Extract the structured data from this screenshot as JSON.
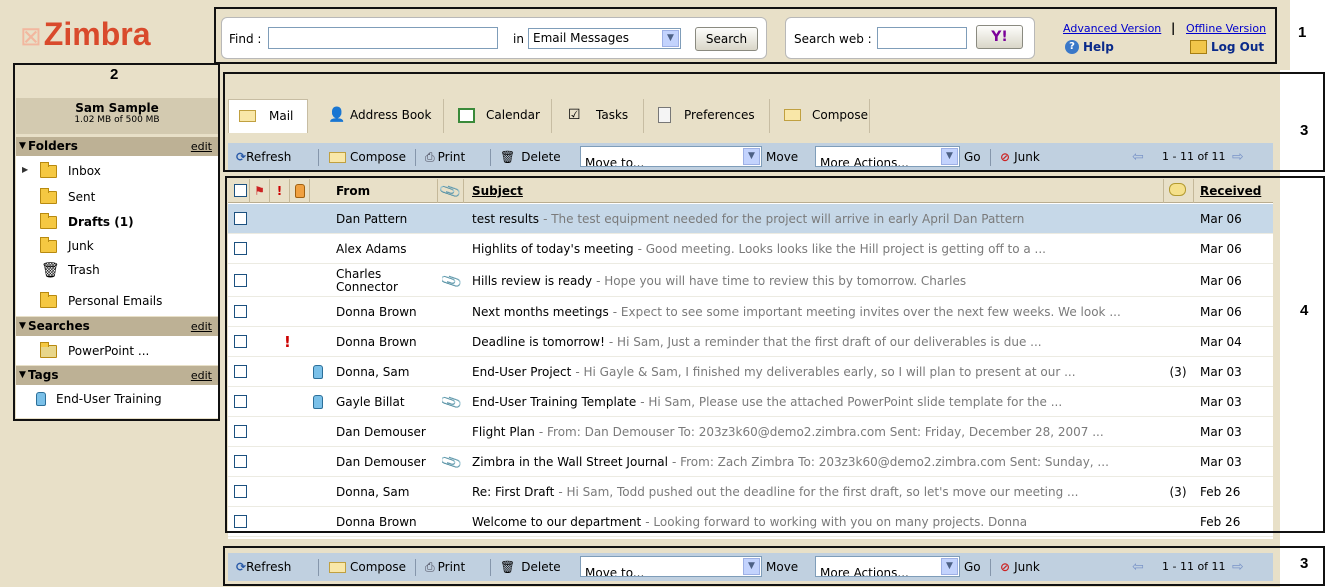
{
  "header": {
    "logo": "Zimbra",
    "find_label": "Find :",
    "in_label": "in",
    "search_scope": "Email Messages",
    "search_button": "Search",
    "search_web_label": "Search web :",
    "web_button": "Y!",
    "advanced_version": "Advanced Version",
    "separator": "|",
    "offline_version": "Offline Version",
    "help": "Help",
    "logout": "Log Out"
  },
  "callouts": {
    "c1": "1",
    "c2": "2",
    "c3": "3",
    "c4": "4",
    "c3b": "3"
  },
  "sidebar": {
    "user_name": "Sam Sample",
    "quota": "1.02 MB of 500 MB",
    "folders_header": "Folders",
    "edit": "edit",
    "folders": [
      {
        "label": "Inbox"
      },
      {
        "label": "Sent"
      },
      {
        "label": "Drafts (1)"
      },
      {
        "label": "Junk"
      },
      {
        "label": "Trash"
      },
      {
        "label": "Personal Emails"
      }
    ],
    "searches_header": "Searches",
    "searches": [
      {
        "label": "PowerPoint ..."
      }
    ],
    "tags_header": "Tags",
    "tags": [
      {
        "label": "End-User Training"
      }
    ]
  },
  "tabs": [
    {
      "label": "Mail"
    },
    {
      "label": "Address Book"
    },
    {
      "label": "Calendar"
    },
    {
      "label": "Tasks"
    },
    {
      "label": "Preferences"
    },
    {
      "label": "Compose"
    }
  ],
  "toolbar": {
    "refresh": "Refresh",
    "compose": "Compose",
    "print": "Print",
    "delete": "Delete",
    "move_to": "Move to...",
    "move": "Move",
    "more_actions": "More Actions...",
    "go": "Go",
    "junk": "Junk",
    "paging": "1 - 11  of 11"
  },
  "list": {
    "headers": {
      "from": "From",
      "subject": "Subject",
      "received": "Received"
    },
    "rows": [
      {
        "from": "Dan Pattern",
        "subject": "test results",
        "fragment": "- The test equipment needed for the project will arrive in early April Dan Pattern",
        "count": "",
        "date": "Mar 06"
      },
      {
        "from": "Alex Adams",
        "subject": "Highlits of today's meeting",
        "fragment": "- Good meeting. Looks looks like the Hill project is getting off to a ...",
        "count": "",
        "date": "Mar 06"
      },
      {
        "from": "Charles Connector",
        "subject": "Hills review is ready",
        "fragment": "- Hope you will have time to review this by tomorrow. Charles",
        "count": "",
        "date": "Mar 06"
      },
      {
        "from": "Donna Brown",
        "subject": "Next months meetings",
        "fragment": "- Expect to see some important meeting invites over the next few weeks. We look ...",
        "count": "",
        "date": "Mar 06"
      },
      {
        "from": "Donna Brown",
        "subject": "Deadline is tomorrow!",
        "fragment": "- Hi Sam, Just a reminder that the first draft of our deliverables is due ...",
        "count": "",
        "date": "Mar 04"
      },
      {
        "from": "Donna, Sam",
        "subject": "End-User Project",
        "fragment": "- Hi Gayle & Sam, I finished my deliverables early, so I will plan to present at our ...",
        "count": "(3)",
        "date": "Mar 03"
      },
      {
        "from": "Gayle Billat",
        "subject": "End-User Training Template",
        "fragment": "- Hi Sam, Please use the attached PowerPoint slide template for the ...",
        "count": "",
        "date": "Mar 03"
      },
      {
        "from": "Dan Demouser",
        "subject": "Flight Plan",
        "fragment": "- From: Dan Demouser To: 203z3k60@demo2.zimbra.com Sent: Friday, December 28, 2007 ...",
        "count": "",
        "date": "Mar 03"
      },
      {
        "from": "Dan Demouser",
        "subject": "Zimbra in the Wall Street Journal",
        "fragment": "- From: Zach Zimbra To: 203z3k60@demo2.zimbra.com Sent: Sunday, ...",
        "count": "",
        "date": "Mar 03"
      },
      {
        "from": "Donna, Sam",
        "subject": "Re: First Draft",
        "fragment": "- Hi Sam, Todd pushed out the deadline for the first draft, so let's move our meeting ...",
        "count": "(3)",
        "date": "Feb 26"
      },
      {
        "from": "Donna Brown",
        "subject": "Welcome to our department",
        "fragment": "- Looking forward to working with you on many projects. Donna",
        "count": "",
        "date": "Feb 26"
      }
    ]
  }
}
